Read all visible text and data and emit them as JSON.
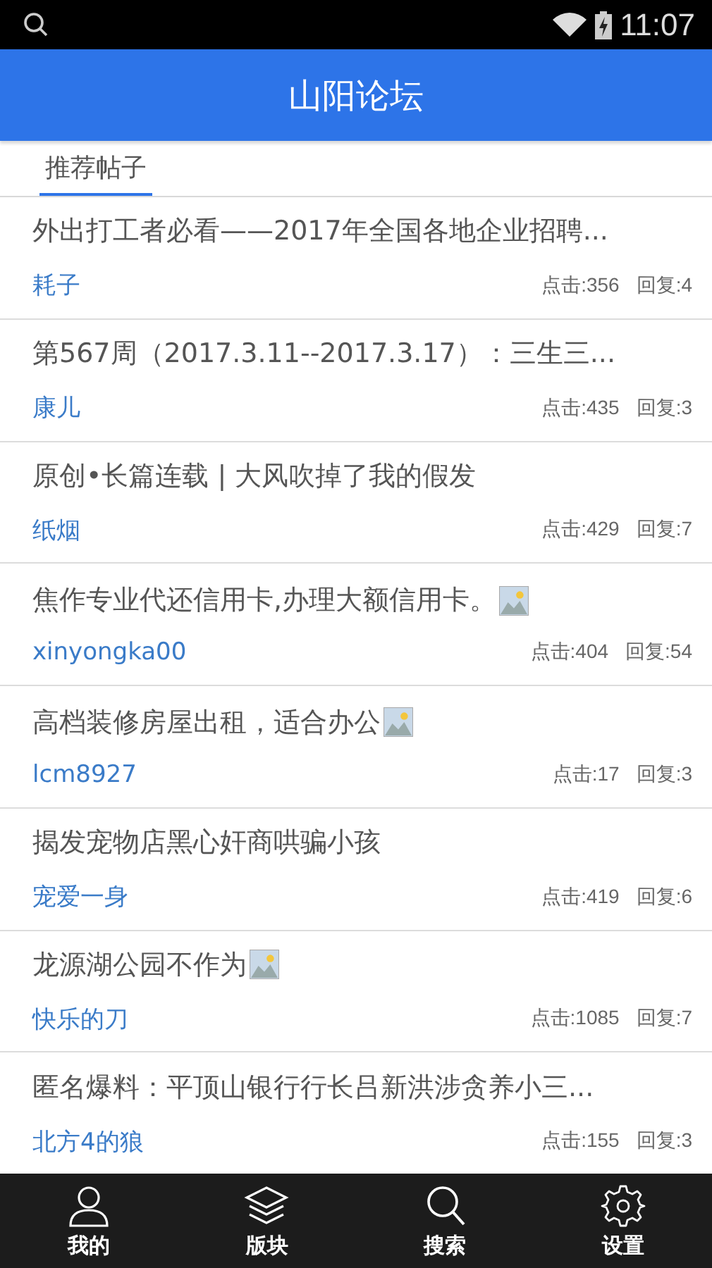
{
  "status_bar": {
    "time": "11:07"
  },
  "header": {
    "title": "山阳论坛"
  },
  "tabs": [
    {
      "label": "推荐帖子",
      "selected": true
    }
  ],
  "posts": [
    {
      "title": "外出打工者必看——2017年全国各地企业招聘...",
      "image": false,
      "author": "耗子",
      "clicks": "点击:356",
      "replies": "回复:4"
    },
    {
      "title": "第567周（2017.3.11--2017.3.17）：三生三...",
      "image": false,
      "author": "康儿",
      "clicks": "点击:435",
      "replies": "回复:3"
    },
    {
      "title": "原创•长篇连载 | 大风吹掉了我的假发",
      "image": false,
      "author": "纸烟",
      "clicks": "点击:429",
      "replies": "回复:7"
    },
    {
      "title": "焦作专业代还信用卡,办理大额信用卡。",
      "image": true,
      "author": "xinyongka00",
      "clicks": "点击:404",
      "replies": "回复:54"
    },
    {
      "title": "高档装修房屋出租，适合办公",
      "image": true,
      "author": "lcm8927",
      "clicks": "点击:17",
      "replies": "回复:3"
    },
    {
      "title": "揭发宠物店黑心奸商哄骗小孩",
      "image": false,
      "author": "宠爱一身",
      "clicks": "点击:419",
      "replies": "回复:6"
    },
    {
      "title": "龙源湖公园不作为",
      "image": true,
      "author": "快乐的刀",
      "clicks": "点击:1085",
      "replies": "回复:7"
    },
    {
      "title": "匿名爆料：平顶山银行行长吕新洪涉贪养小三...",
      "image": false,
      "author": "北方4的狼",
      "clicks": "点击:155",
      "replies": "回复:3"
    }
  ],
  "bottom_nav": [
    {
      "kind": "person",
      "label": "我的"
    },
    {
      "kind": "layers",
      "label": "版块"
    },
    {
      "kind": "search",
      "label": "搜索"
    },
    {
      "kind": "settings",
      "label": "设置"
    }
  ]
}
